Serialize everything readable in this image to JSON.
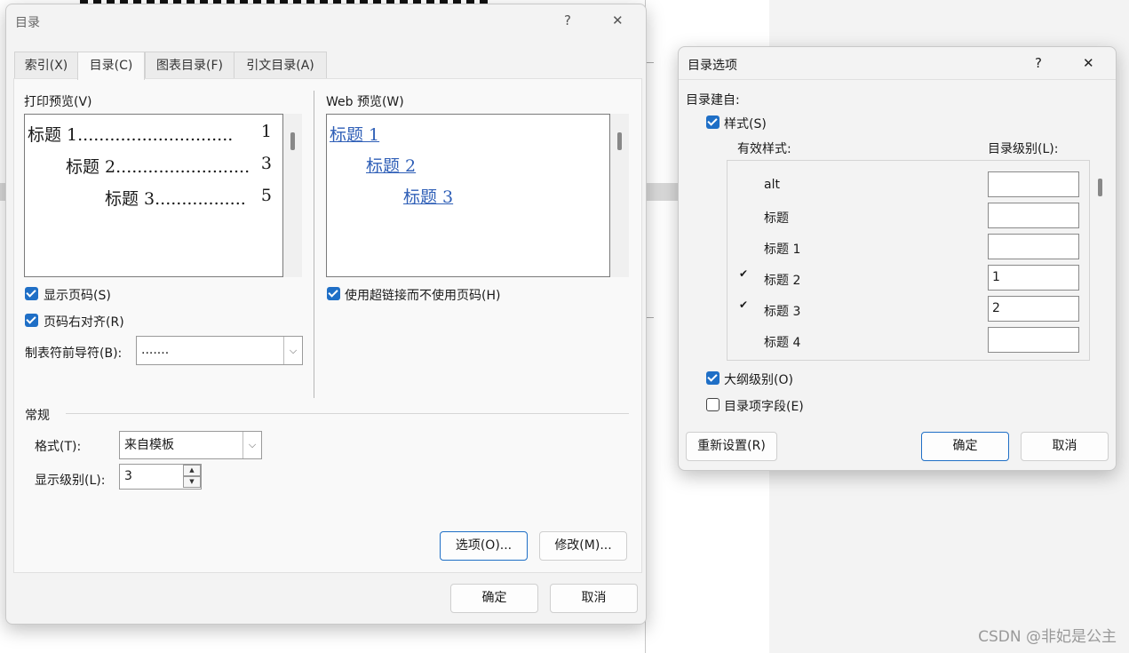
{
  "background": {
    "watermark": "CSDN @非妃是公主"
  },
  "toc_dialog": {
    "title": "目录",
    "help": "?",
    "close": "✕",
    "tabs": [
      "索引(X)",
      "目录(C)",
      "图表目录(F)",
      "引文目录(A)"
    ],
    "active_tab_index": 1,
    "print_preview_label": "打印预览(V)",
    "print_preview_lines": [
      {
        "text": "标题 1.............................",
        "page": "1"
      },
      {
        "text": "标题 2.........................",
        "page": "3"
      },
      {
        "text": "标题 3.................",
        "page": "5"
      }
    ],
    "web_preview_label": "Web 预览(W)",
    "web_preview_links": [
      "标题 1",
      "标题 2",
      "标题 3"
    ],
    "show_page_numbers": {
      "label": "显示页码(S)",
      "checked": true
    },
    "right_align": {
      "label": "页码右对齐(R)",
      "checked": true
    },
    "use_hyperlinks": {
      "label": "使用超链接而不使用页码(H)",
      "checked": true
    },
    "tab_leader_label": "制表符前导符(B):",
    "tab_leader_value": ".......",
    "general_label": "常规",
    "format_label": "格式(T):",
    "format_value": "来自模板",
    "levels_label": "显示级别(L):",
    "levels_value": "3",
    "options_button": "选项(O)...",
    "modify_button": "修改(M)...",
    "ok_button": "确定",
    "cancel_button": "取消"
  },
  "options_dialog": {
    "title": "目录选项",
    "help": "?",
    "close": "✕",
    "build_from_label": "目录建自:",
    "styles_checkbox": {
      "label": "样式(S)",
      "checked": true
    },
    "available_styles_header": "有效样式:",
    "toc_level_header": "目录级别(L):",
    "styles": [
      {
        "name": "alt",
        "level": "",
        "checked": false
      },
      {
        "name": "标题",
        "level": "",
        "checked": false
      },
      {
        "name": "标题 1",
        "level": "",
        "checked": false
      },
      {
        "name": "标题 2",
        "level": "1",
        "checked": true
      },
      {
        "name": "标题 3",
        "level": "2",
        "checked": true
      },
      {
        "name": "标题 4",
        "level": "",
        "checked": false
      }
    ],
    "tick_mark": "✔",
    "outline_checkbox": {
      "label": "大纲级别(O)",
      "checked": true
    },
    "fields_checkbox": {
      "label": "目录项字段(E)",
      "checked": false
    },
    "reset_button": "重新设置(R)",
    "ok_button": "确定",
    "cancel_button": "取消"
  }
}
